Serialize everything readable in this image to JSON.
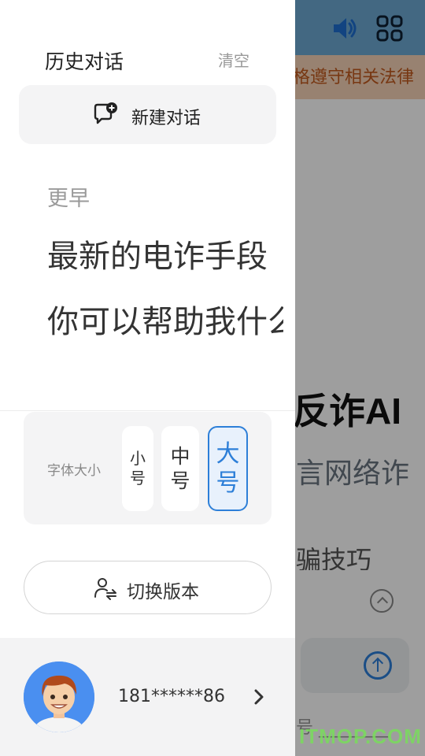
{
  "drawer": {
    "title": "历史对话",
    "clear_label": "清空",
    "new_chat_label": "新建对话",
    "section_earlier": "更早",
    "history_items": [
      {
        "title": "最新的电诈手段"
      },
      {
        "title": "你可以帮助我什么"
      }
    ],
    "font_size": {
      "label": "字体大小",
      "options": [
        "小号",
        "中号",
        "大号"
      ],
      "selected": "大号"
    },
    "switch_version_label": "切换版本",
    "user": {
      "phone": "181******86"
    }
  },
  "background_app": {
    "banner_text": "格遵守相关法律",
    "title": "反诈AI",
    "subtitle": "言网络诈",
    "tip": "骗技巧",
    "footer": "号 ________"
  },
  "watermark": "ITMOP.COM",
  "colors": {
    "accent": "#2d7fd8",
    "header_blue": "#6da9d2",
    "banner_orange": "#f6d2b6",
    "panel_gray": "#f4f4f5"
  }
}
